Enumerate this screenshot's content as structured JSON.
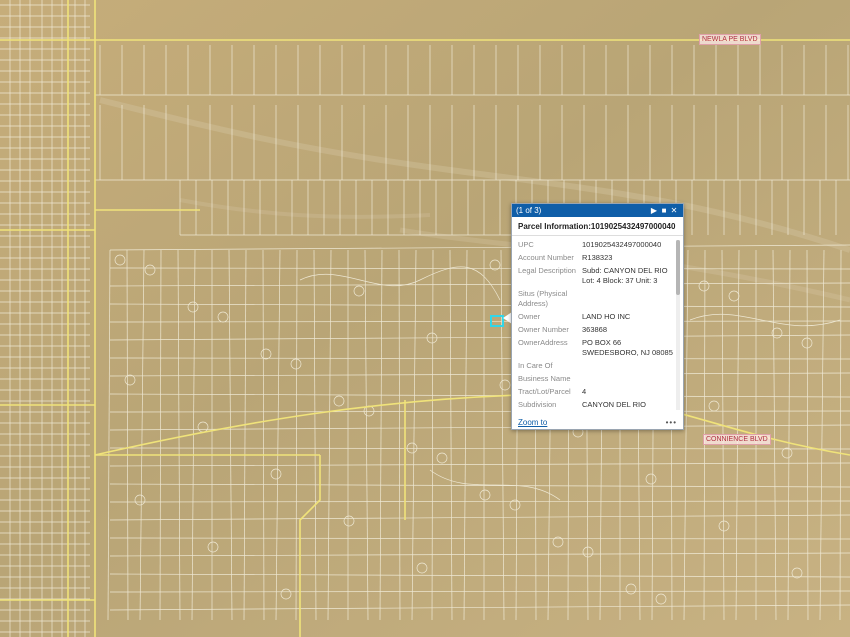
{
  "map": {
    "background_color": "#c3ab7c",
    "road_color": "#f0e37a",
    "parcel_line_color": "#f7f3e3",
    "selection_color": "#32d6e8",
    "road_labels": [
      "NEWLA PE BLVD",
      "",
      "",
      "CONNIENCE BLVD"
    ]
  },
  "popup": {
    "counter": "(1 of 3)",
    "next_icon": "play-triangle",
    "maximize_icon": "square",
    "close_icon": "x",
    "title": "Parcel Information:1019025432497000040",
    "fields": [
      {
        "key": "UPC",
        "value": "1019025432497000040"
      },
      {
        "key": "Account Number",
        "value": "R138323"
      },
      {
        "key": "Legal Description",
        "value": "Subd: CANYON DEL RIO Lot: 4 Block: 37 Unit: 3"
      },
      {
        "key": "Situs (Physical Address)",
        "value": ""
      },
      {
        "key": "Owner",
        "value": "LAND HO INC"
      },
      {
        "key": "Owner Number",
        "value": "363868"
      },
      {
        "key": "OwnerAddress",
        "value": "PO BOX 66 SWEDESBORO, NJ 08085"
      },
      {
        "key": "In Care Of",
        "value": ""
      },
      {
        "key": "Business Name",
        "value": ""
      },
      {
        "key": "Tract/Lot/Parcel",
        "value": "4"
      },
      {
        "key": "Subdivision",
        "value": "CANYON DEL RIO"
      }
    ],
    "zoom_link": "Zoom to",
    "more_label": "•••"
  }
}
